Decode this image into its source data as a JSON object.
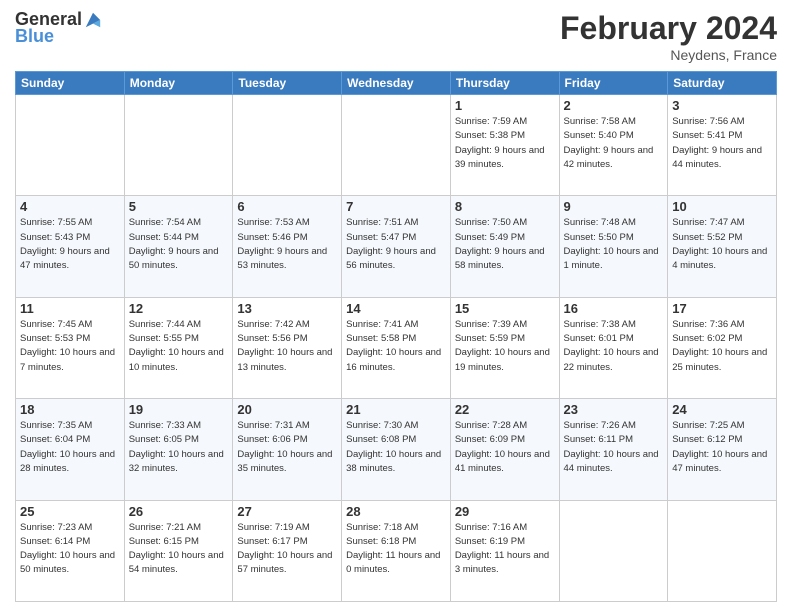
{
  "header": {
    "logo_line1": "General",
    "logo_line2": "Blue",
    "month": "February 2024",
    "location": "Neydens, France"
  },
  "weekdays": [
    "Sunday",
    "Monday",
    "Tuesday",
    "Wednesday",
    "Thursday",
    "Friday",
    "Saturday"
  ],
  "weeks": [
    [
      {
        "day": "",
        "sunrise": "",
        "sunset": "",
        "daylight": ""
      },
      {
        "day": "",
        "sunrise": "",
        "sunset": "",
        "daylight": ""
      },
      {
        "day": "",
        "sunrise": "",
        "sunset": "",
        "daylight": ""
      },
      {
        "day": "",
        "sunrise": "",
        "sunset": "",
        "daylight": ""
      },
      {
        "day": "1",
        "sunrise": "Sunrise: 7:59 AM",
        "sunset": "Sunset: 5:38 PM",
        "daylight": "Daylight: 9 hours and 39 minutes."
      },
      {
        "day": "2",
        "sunrise": "Sunrise: 7:58 AM",
        "sunset": "Sunset: 5:40 PM",
        "daylight": "Daylight: 9 hours and 42 minutes."
      },
      {
        "day": "3",
        "sunrise": "Sunrise: 7:56 AM",
        "sunset": "Sunset: 5:41 PM",
        "daylight": "Daylight: 9 hours and 44 minutes."
      }
    ],
    [
      {
        "day": "4",
        "sunrise": "Sunrise: 7:55 AM",
        "sunset": "Sunset: 5:43 PM",
        "daylight": "Daylight: 9 hours and 47 minutes."
      },
      {
        "day": "5",
        "sunrise": "Sunrise: 7:54 AM",
        "sunset": "Sunset: 5:44 PM",
        "daylight": "Daylight: 9 hours and 50 minutes."
      },
      {
        "day": "6",
        "sunrise": "Sunrise: 7:53 AM",
        "sunset": "Sunset: 5:46 PM",
        "daylight": "Daylight: 9 hours and 53 minutes."
      },
      {
        "day": "7",
        "sunrise": "Sunrise: 7:51 AM",
        "sunset": "Sunset: 5:47 PM",
        "daylight": "Daylight: 9 hours and 56 minutes."
      },
      {
        "day": "8",
        "sunrise": "Sunrise: 7:50 AM",
        "sunset": "Sunset: 5:49 PM",
        "daylight": "Daylight: 9 hours and 58 minutes."
      },
      {
        "day": "9",
        "sunrise": "Sunrise: 7:48 AM",
        "sunset": "Sunset: 5:50 PM",
        "daylight": "Daylight: 10 hours and 1 minute."
      },
      {
        "day": "10",
        "sunrise": "Sunrise: 7:47 AM",
        "sunset": "Sunset: 5:52 PM",
        "daylight": "Daylight: 10 hours and 4 minutes."
      }
    ],
    [
      {
        "day": "11",
        "sunrise": "Sunrise: 7:45 AM",
        "sunset": "Sunset: 5:53 PM",
        "daylight": "Daylight: 10 hours and 7 minutes."
      },
      {
        "day": "12",
        "sunrise": "Sunrise: 7:44 AM",
        "sunset": "Sunset: 5:55 PM",
        "daylight": "Daylight: 10 hours and 10 minutes."
      },
      {
        "day": "13",
        "sunrise": "Sunrise: 7:42 AM",
        "sunset": "Sunset: 5:56 PM",
        "daylight": "Daylight: 10 hours and 13 minutes."
      },
      {
        "day": "14",
        "sunrise": "Sunrise: 7:41 AM",
        "sunset": "Sunset: 5:58 PM",
        "daylight": "Daylight: 10 hours and 16 minutes."
      },
      {
        "day": "15",
        "sunrise": "Sunrise: 7:39 AM",
        "sunset": "Sunset: 5:59 PM",
        "daylight": "Daylight: 10 hours and 19 minutes."
      },
      {
        "day": "16",
        "sunrise": "Sunrise: 7:38 AM",
        "sunset": "Sunset: 6:01 PM",
        "daylight": "Daylight: 10 hours and 22 minutes."
      },
      {
        "day": "17",
        "sunrise": "Sunrise: 7:36 AM",
        "sunset": "Sunset: 6:02 PM",
        "daylight": "Daylight: 10 hours and 25 minutes."
      }
    ],
    [
      {
        "day": "18",
        "sunrise": "Sunrise: 7:35 AM",
        "sunset": "Sunset: 6:04 PM",
        "daylight": "Daylight: 10 hours and 28 minutes."
      },
      {
        "day": "19",
        "sunrise": "Sunrise: 7:33 AM",
        "sunset": "Sunset: 6:05 PM",
        "daylight": "Daylight: 10 hours and 32 minutes."
      },
      {
        "day": "20",
        "sunrise": "Sunrise: 7:31 AM",
        "sunset": "Sunset: 6:06 PM",
        "daylight": "Daylight: 10 hours and 35 minutes."
      },
      {
        "day": "21",
        "sunrise": "Sunrise: 7:30 AM",
        "sunset": "Sunset: 6:08 PM",
        "daylight": "Daylight: 10 hours and 38 minutes."
      },
      {
        "day": "22",
        "sunrise": "Sunrise: 7:28 AM",
        "sunset": "Sunset: 6:09 PM",
        "daylight": "Daylight: 10 hours and 41 minutes."
      },
      {
        "day": "23",
        "sunrise": "Sunrise: 7:26 AM",
        "sunset": "Sunset: 6:11 PM",
        "daylight": "Daylight: 10 hours and 44 minutes."
      },
      {
        "day": "24",
        "sunrise": "Sunrise: 7:25 AM",
        "sunset": "Sunset: 6:12 PM",
        "daylight": "Daylight: 10 hours and 47 minutes."
      }
    ],
    [
      {
        "day": "25",
        "sunrise": "Sunrise: 7:23 AM",
        "sunset": "Sunset: 6:14 PM",
        "daylight": "Daylight: 10 hours and 50 minutes."
      },
      {
        "day": "26",
        "sunrise": "Sunrise: 7:21 AM",
        "sunset": "Sunset: 6:15 PM",
        "daylight": "Daylight: 10 hours and 54 minutes."
      },
      {
        "day": "27",
        "sunrise": "Sunrise: 7:19 AM",
        "sunset": "Sunset: 6:17 PM",
        "daylight": "Daylight: 10 hours and 57 minutes."
      },
      {
        "day": "28",
        "sunrise": "Sunrise: 7:18 AM",
        "sunset": "Sunset: 6:18 PM",
        "daylight": "Daylight: 11 hours and 0 minutes."
      },
      {
        "day": "29",
        "sunrise": "Sunrise: 7:16 AM",
        "sunset": "Sunset: 6:19 PM",
        "daylight": "Daylight: 11 hours and 3 minutes."
      },
      {
        "day": "",
        "sunrise": "",
        "sunset": "",
        "daylight": ""
      },
      {
        "day": "",
        "sunrise": "",
        "sunset": "",
        "daylight": ""
      }
    ]
  ]
}
